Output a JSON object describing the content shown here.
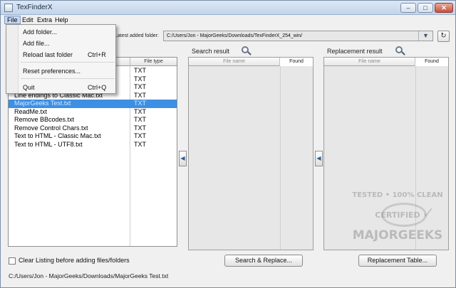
{
  "window": {
    "title": "TexFinderX",
    "controls": {
      "minimize": "–",
      "maximize": "□",
      "close": "✕"
    }
  },
  "menubar": {
    "items": [
      "File",
      "Edit",
      "Extra",
      "Help"
    ],
    "active": "File"
  },
  "file_menu": {
    "items": [
      {
        "label": "Add folder...",
        "shortcut": ""
      },
      {
        "label": "Add file...",
        "shortcut": ""
      },
      {
        "label": "Reload last folder",
        "shortcut": "Ctrl+R"
      },
      {
        "label": "Reset preferences...",
        "shortcut": ""
      },
      {
        "label": "Quit",
        "shortcut": "Ctrl+Q"
      }
    ]
  },
  "toolbar": {
    "latest_folder_label": "Latest added folder:",
    "latest_folder_value": "C:/Users/Jon - MajorGeeks/Downloads/TexFinderX_254_win/",
    "dropdown_icon": "chevron-down-icon",
    "refresh_icon": "refresh-icon"
  },
  "file_list": {
    "columns": [
      "",
      "File type"
    ],
    "rows": [
      {
        "name": "",
        "type": "TXT"
      },
      {
        "name": "",
        "type": "TXT"
      },
      {
        "name": "",
        "type": "TXT"
      },
      {
        "name": "Line endings to Classic Mac.txt",
        "type": "TXT"
      },
      {
        "name": "MajorGeeks Test.txt",
        "type": "TXT",
        "selected": true
      },
      {
        "name": "ReadMe.txt",
        "type": "TXT"
      },
      {
        "name": "Remove BBcodes.txt",
        "type": "TXT"
      },
      {
        "name": "Remove Control Chars.txt",
        "type": "TXT"
      },
      {
        "name": "Text to HTML - Classic Mac.txt",
        "type": "TXT"
      },
      {
        "name": "Text to HTML - UTF8.txt",
        "type": "TXT"
      }
    ]
  },
  "search_panel": {
    "title": "Search result",
    "columns": [
      "File name",
      "Found"
    ]
  },
  "replace_panel": {
    "title": "Replacement result",
    "columns": [
      "File name",
      "Found"
    ]
  },
  "arrows": {
    "left": "◀"
  },
  "footer": {
    "clear_listing_label": "Clear Listing before adding files/folders",
    "search_replace_button": "Search & Replace...",
    "replacement_table_button": "Replacement Table...",
    "status_path": "C:/Users/Jon - MajorGeeks/Downloads/MajorGeeks Test.txt"
  },
  "watermark": {
    "line1": "TESTED • 100% CLEAN",
    "line2": "CERTIFIED",
    "line3": "MAJORGEEKS"
  },
  "colors": {
    "selection": "#3d8fe3",
    "menu_active": "#c7d7ee"
  }
}
